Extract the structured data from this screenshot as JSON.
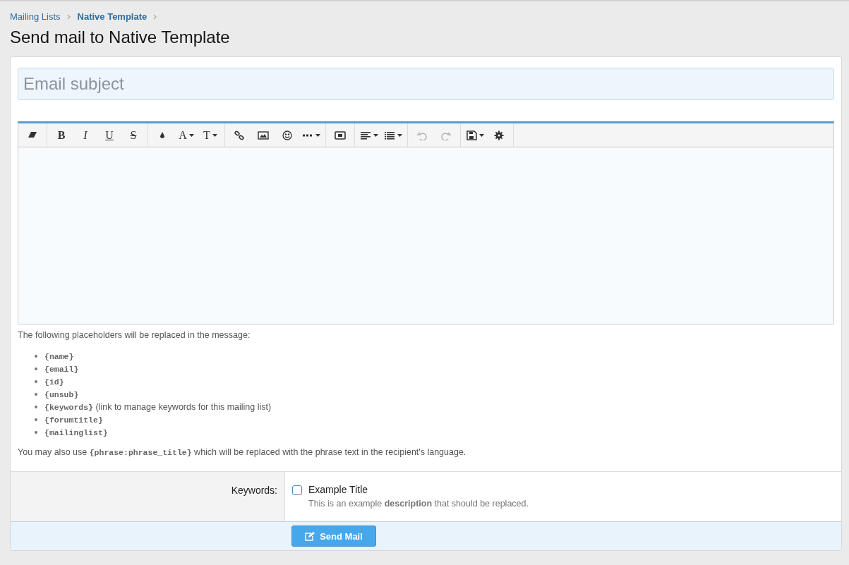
{
  "breadcrumb": [
    {
      "label": "Mailing Lists",
      "current": false
    },
    {
      "label": "Native Template",
      "current": true
    }
  ],
  "title": "Send mail to Native Template",
  "subject": {
    "placeholder": "Email subject"
  },
  "toolbar": [
    [
      {
        "kind": "eraser",
        "disabled": false,
        "dropdown": false
      }
    ],
    [
      {
        "kind": "text",
        "label": "B",
        "disabled": false,
        "dropdown": false
      },
      {
        "kind": "text",
        "label": "I",
        "disabled": false,
        "dropdown": false
      },
      {
        "kind": "text",
        "label": "U",
        "disabled": false,
        "dropdown": false
      },
      {
        "kind": "text",
        "label": "S",
        "disabled": false,
        "dropdown": false
      }
    ],
    [
      {
        "kind": "color",
        "disabled": false,
        "dropdown": false
      },
      {
        "kind": "text",
        "label": "A",
        "disabled": false,
        "dropdown": true
      },
      {
        "kind": "text",
        "label": "T",
        "disabled": false,
        "dropdown": true
      }
    ],
    [
      {
        "kind": "link",
        "disabled": false,
        "dropdown": false
      },
      {
        "kind": "image",
        "disabled": false,
        "dropdown": false
      },
      {
        "kind": "smiley",
        "disabled": false,
        "dropdown": false
      },
      {
        "kind": "more",
        "disabled": false,
        "dropdown": true
      }
    ],
    [
      {
        "kind": "media",
        "disabled": false,
        "dropdown": false
      }
    ],
    [
      {
        "kind": "align",
        "disabled": false,
        "dropdown": true
      },
      {
        "kind": "list",
        "disabled": false,
        "dropdown": true
      }
    ],
    [
      {
        "kind": "undo",
        "disabled": true,
        "dropdown": false
      },
      {
        "kind": "redo",
        "disabled": true,
        "dropdown": false
      }
    ],
    [
      {
        "kind": "save",
        "disabled": false,
        "dropdown": true
      },
      {
        "kind": "gear",
        "disabled": false,
        "dropdown": false
      }
    ]
  ],
  "placeholders_intro": "The following placeholders will be replaced in the message:",
  "placeholders": [
    {
      "code": "{name}"
    },
    {
      "code": "{email}"
    },
    {
      "code": "{id}"
    },
    {
      "code": "{unsub}"
    },
    {
      "code": "{keywords}",
      "note": "(link to manage keywords for this mailing list)"
    },
    {
      "code": "{forumtitle}"
    },
    {
      "code": "{mailinglist}"
    }
  ],
  "phrase_note": {
    "before": "You may also use",
    "code": "{phrase:phrase_title}",
    "after": "which will be replaced with the phrase text in the recipient's language."
  },
  "keywords": {
    "label": "Keywords:",
    "options": [
      {
        "title": "Example Title",
        "description": "This is an example **description** that should be replaced.",
        "checked": false
      }
    ]
  },
  "submit": "Send Mail"
}
